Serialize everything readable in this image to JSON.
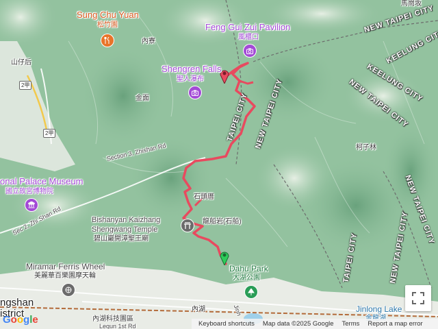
{
  "map": {
    "colors": {
      "terrain": "#8fbf9c",
      "route": "#e84a5f",
      "end_marker": "#e84a5f",
      "start_marker": "#2ecc5a",
      "city_boundary": "#6c6c6c",
      "poi": "#a34ad6",
      "food": "#e8742a",
      "park": "#2a9d57"
    },
    "places": {
      "sung_chu_yuan": {
        "name": "Sung Chu Yuan",
        "local": "松竹園",
        "icon": "food-icon"
      },
      "feng_gui_zui": {
        "name": "Feng Gui Zui Pavilion",
        "local": "風櫃口",
        "icon": "camera-icon"
      },
      "shengren_falls": {
        "name": "Shengren Falls",
        "local": "聖人瀑布",
        "icon": "camera-icon"
      },
      "palace_museum": {
        "name": "onal Palace Museum",
        "local": "國立故宮博物院",
        "icon": "museum-icon"
      },
      "bishanyan": {
        "name_line1": "Bishanyan Kaizhang",
        "name_line2": "Shengwang Temple",
        "local": "碧山巖開漳聖王廟",
        "icon": "temple-icon"
      },
      "miramar": {
        "name": "Miramar Ferris Wheel",
        "local": "美麗華百樂園摩天輪",
        "icon": "ferris-wheel-icon"
      },
      "dahu_park": {
        "name": "Dahu Park",
        "local": "大湖公園",
        "icon": "tree-icon"
      },
      "jinlong_lake": {
        "name": "Jinlong Lake",
        "local": "金龍湖"
      }
    },
    "areas": [
      {
        "key": "neiliao",
        "text": "內寮"
      },
      {
        "key": "shanzaihou",
        "text": "山仔后"
      },
      {
        "key": "jinmian",
        "text": "金面"
      },
      {
        "key": "kezilin",
        "text": "柯子林"
      },
      {
        "key": "shitoucuo",
        "text": "石頭厝"
      },
      {
        "key": "longchuanyan",
        "text": "龍船岩(石船)"
      },
      {
        "key": "neihu",
        "text": "內湖"
      },
      {
        "key": "neihu_tech",
        "text": "內湖科技園區"
      },
      {
        "key": "top_right",
        "text": "馬崗坂"
      },
      {
        "key": "gangshan",
        "text": "ngshan"
      },
      {
        "key": "district",
        "text": "istrict"
      }
    ],
    "cities": [
      {
        "key": "new_taipei_1",
        "text": "NEW TAIPEI CITY"
      },
      {
        "key": "keelung_1",
        "text": "KEELUNG CITY"
      },
      {
        "key": "keelung_2",
        "text": "KEELUNG CITY"
      },
      {
        "key": "new_taipei_2",
        "text": "NEW TAIPEI CITY"
      },
      {
        "key": "taipei_1",
        "text": "TAIPEI CITY"
      },
      {
        "key": "new_taipei_3",
        "text": "NEW TAIPEI CITY"
      },
      {
        "key": "new_taipei_4",
        "text": "NEW TAIPEI CITY"
      },
      {
        "key": "new_taipei_5",
        "text": "NEW TAIPEI CITY"
      },
      {
        "key": "taipei_2",
        "text": "TAIPEI CITY"
      }
    ],
    "roads": [
      {
        "key": "zhishan3",
        "text": "Section 3, Zhishan Rd"
      },
      {
        "key": "zhishan2",
        "text": "Sec 2, Zhi Shan Rd"
      },
      {
        "key": "lequn",
        "text": "Lequn 1st Rd"
      },
      {
        "key": "jinhu",
        "text": "Jinh"
      }
    ],
    "route_badges": [
      {
        "key": "r2",
        "text": "2甲"
      },
      {
        "key": "r2b",
        "text": "2甲"
      }
    ],
    "attribution": {
      "shortcuts": "Keyboard shortcuts",
      "data": "Map data ©2025 Google",
      "terms": "Terms",
      "report": "Report a map error"
    },
    "google_logo": "Google",
    "fullscreen_icon": "fullscreen-icon"
  }
}
